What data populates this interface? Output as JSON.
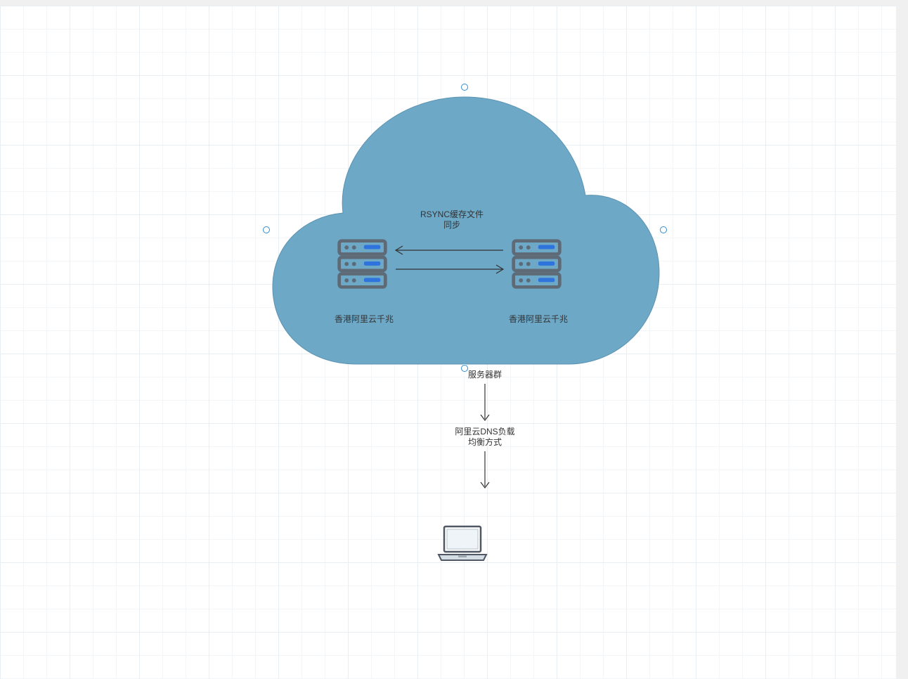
{
  "diagram": {
    "cloud_label": "服务器群",
    "server_left_label": "香港阿里云千兆",
    "server_right_label": "香港阿里云千兆",
    "sync_label_line1": "RSYNC缓存文件",
    "sync_label_line2": "同步",
    "dns_label_line1": "阿里云DNS负载",
    "dns_label_line2": "均衡方式"
  },
  "colors": {
    "cloud_fill": "#6da8c7",
    "cloud_stroke": "#5c93b1",
    "server_body": "#5e6a76",
    "server_led": "#2f74dd",
    "arrow": "#3a3a3a",
    "handle": "#2f8dd6"
  },
  "icons": {
    "cloud": "cloud-icon",
    "server": "server-rack-icon",
    "laptop": "laptop-icon",
    "arrow_bidir": "double-arrow-icon",
    "arrow_down": "arrow-down-icon",
    "selection_handle": "selection-handle-icon"
  }
}
